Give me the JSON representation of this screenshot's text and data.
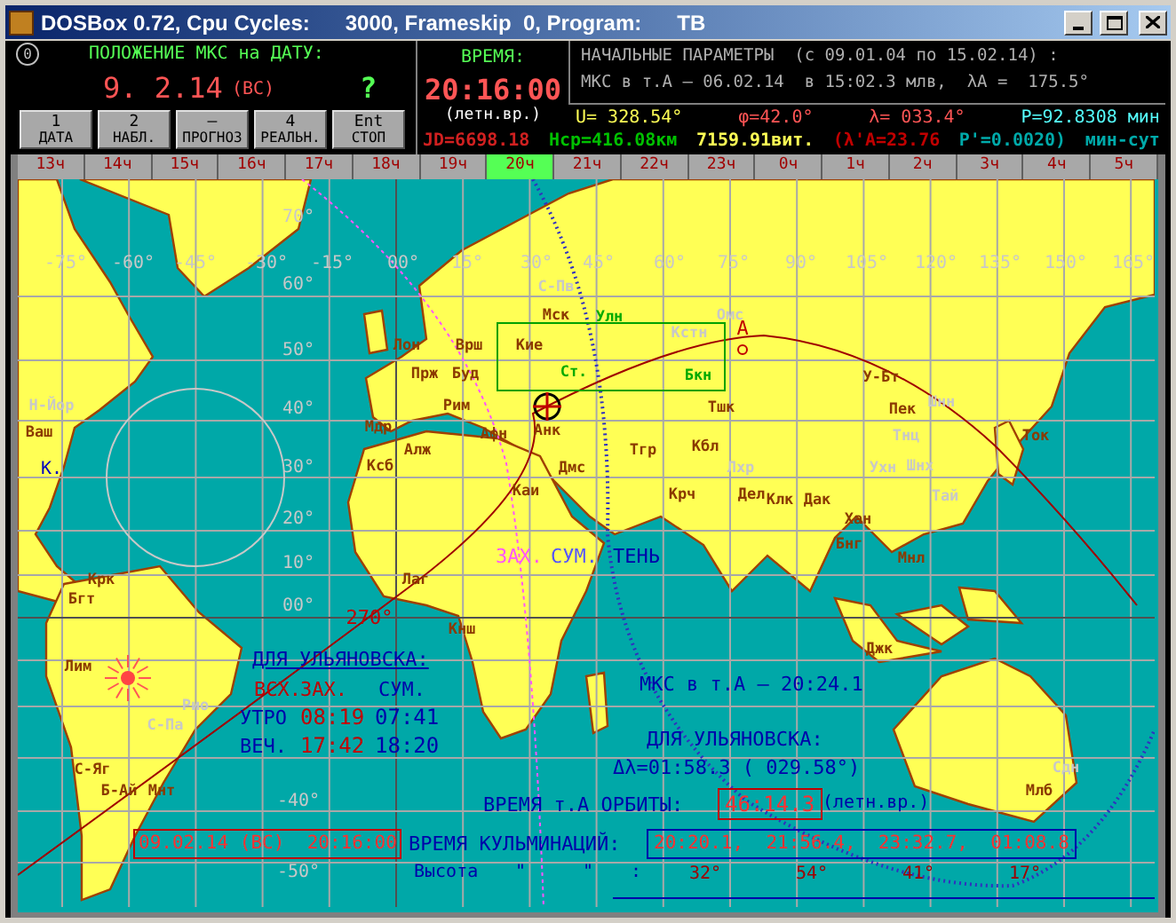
{
  "window": {
    "title": "DOSBox 0.72, Cpu Cycles:      3000, Frameskip  0, Program:      TB"
  },
  "header": {
    "badge": "0",
    "heading": "ПОЛОЖЕНИЕ МКС на ДАТУ:",
    "date": "9. 2.14",
    "weekday": "(ВС)",
    "query": "?",
    "buttons": [
      {
        "key": "1",
        "label": "ДАТА"
      },
      {
        "key": "2",
        "label": "НАБЛ."
      },
      {
        "key": "–",
        "label": "ПРОГНОЗ"
      },
      {
        "key": "4",
        "label": "РЕАЛЬН."
      },
      {
        "key": "Ent",
        "label": "СТОП"
      }
    ],
    "time_heading": "ВРЕМЯ:",
    "time": "20:16:00",
    "time_note": "(летн.вр.)",
    "params_title": "НАЧАЛЬНЫЕ ПАРАМЕТРЫ  (с 09.01.04 по 15.02.14) :",
    "params_line": "МКС в т.А – 06.02.14  в 15:02.3 млв,  λA =  175.5°",
    "readings": [
      {
        "text": "U= 328.54°",
        "color": "#ffff55"
      },
      {
        "text": "φ=42.0°",
        "color": "#ff5555"
      },
      {
        "text": "λ= 033.4°",
        "color": "#ff5555"
      },
      {
        "text": "P=92.8308 мин",
        "color": "#55ffff"
      }
    ],
    "stats": [
      {
        "text": "JD=6698.18",
        "color": "#d02020"
      },
      {
        "text": "Hср=416.08км",
        "color": "#00c000"
      },
      {
        "text": "7159.91вит.",
        "color": "#ffff55"
      },
      {
        "text": "(λ'A=23.76",
        "color": "#c00000"
      },
      {
        "text": "P'=0.0020)",
        "color": "#00aaaa"
      },
      {
        "text": "мин-сут",
        "color": "#00aaaa"
      }
    ]
  },
  "hours": [
    {
      "label": "13ч",
      "selected": false
    },
    {
      "label": "14ч",
      "selected": false
    },
    {
      "label": "15ч",
      "selected": false
    },
    {
      "label": "16ч",
      "selected": false
    },
    {
      "label": "17ч",
      "selected": false
    },
    {
      "label": "18ч",
      "selected": false
    },
    {
      "label": "19ч",
      "selected": false
    },
    {
      "label": "20ч",
      "selected": true
    },
    {
      "label": "21ч",
      "selected": false
    },
    {
      "label": "22ч",
      "selected": false
    },
    {
      "label": "23ч",
      "selected": false
    },
    {
      "label": "0ч",
      "selected": false
    },
    {
      "label": "1ч",
      "selected": false
    },
    {
      "label": "2ч",
      "selected": false
    },
    {
      "label": "3ч",
      "selected": false
    },
    {
      "label": "4ч",
      "selected": false
    },
    {
      "label": "5ч",
      "selected": false
    }
  ],
  "map": {
    "longitudes": [
      "-75°",
      "-60°",
      "-45°",
      "-30°",
      "-15°",
      "00°",
      "15°",
      "30°",
      "45°",
      "60°",
      "75°",
      "90°",
      "105°",
      "120°",
      "135°",
      "150°",
      "165°"
    ],
    "latitudes": [
      "70°",
      "60°",
      "50°",
      "40°",
      "30°",
      "20°",
      "10°",
      "00°",
      "-40°",
      "-50°"
    ],
    "cities": [
      {
        "name": "С-Пв",
        "color": "#c8c8c8"
      },
      {
        "name": "Мск",
        "color": "#8b3a00"
      },
      {
        "name": "Улн",
        "color": "#00aa00"
      },
      {
        "name": "Омс",
        "color": "#c8c8c8"
      },
      {
        "name": "Кстн",
        "color": "#c8c8c8"
      },
      {
        "name": "Лон",
        "color": "#8b3a00"
      },
      {
        "name": "Врш",
        "color": "#8b3a00"
      },
      {
        "name": "Кие",
        "color": "#8b3a00"
      },
      {
        "name": "Прж",
        "color": "#8b3a00"
      },
      {
        "name": "Буд",
        "color": "#8b3a00"
      },
      {
        "name": "Ст.",
        "color": "#00aa00"
      },
      {
        "name": "Бкн",
        "color": "#00aa00"
      },
      {
        "name": "У-Бт",
        "color": "#8b3a00"
      },
      {
        "name": "Н-Йор",
        "color": "#c8c8c8"
      },
      {
        "name": "Рим",
        "color": "#8b3a00"
      },
      {
        "name": "Тшк",
        "color": "#8b3a00"
      },
      {
        "name": "Пек",
        "color": "#8b3a00"
      },
      {
        "name": "Шнн",
        "color": "#c8c8c8"
      },
      {
        "name": "Ваш",
        "color": "#8b3a00"
      },
      {
        "name": "Мдр",
        "color": "#8b3a00"
      },
      {
        "name": "Афн",
        "color": "#8b3a00"
      },
      {
        "name": "Анк",
        "color": "#8b3a00"
      },
      {
        "name": "Тнц",
        "color": "#c8c8c8"
      },
      {
        "name": "Ток",
        "color": "#8b3a00"
      },
      {
        "name": "Алж",
        "color": "#8b3a00"
      },
      {
        "name": "Тгр",
        "color": "#8b3a00"
      },
      {
        "name": "Кбл",
        "color": "#8b3a00"
      },
      {
        "name": "Ксб",
        "color": "#8b3a00"
      },
      {
        "name": "Дмс",
        "color": "#8b3a00"
      },
      {
        "name": "Лхр",
        "color": "#c8c8c8"
      },
      {
        "name": "Ухн",
        "color": "#c8c8c8"
      },
      {
        "name": "Шнх",
        "color": "#c8c8c8"
      },
      {
        "name": "Каи",
        "color": "#8b3a00"
      },
      {
        "name": "Крч",
        "color": "#8b3a00"
      },
      {
        "name": "Дел",
        "color": "#8b3a00"
      },
      {
        "name": "Клк",
        "color": "#8b3a00"
      },
      {
        "name": "Дак",
        "color": "#8b3a00"
      },
      {
        "name": "Тай",
        "color": "#c8c8c8"
      },
      {
        "name": "Хан",
        "color": "#8b3a00"
      },
      {
        "name": "Бнг",
        "color": "#8b3a00"
      },
      {
        "name": "Мнл",
        "color": "#8b3a00"
      },
      {
        "name": "Крк",
        "color": "#8b3a00"
      },
      {
        "name": "Лаг",
        "color": "#8b3a00"
      },
      {
        "name": "Бгт",
        "color": "#8b3a00"
      },
      {
        "name": "Кнш",
        "color": "#8b3a00"
      },
      {
        "name": "Джк",
        "color": "#8b3a00"
      },
      {
        "name": "Лим",
        "color": "#8b3a00"
      },
      {
        "name": "Рио",
        "color": "#c8c8c8"
      },
      {
        "name": "С-Па",
        "color": "#c8c8c8"
      },
      {
        "name": "С-Яг",
        "color": "#8b3a00"
      },
      {
        "name": "Сдн",
        "color": "#c8c8c8"
      },
      {
        "name": "Б-Ай",
        "color": "#8b3a00"
      },
      {
        "name": "Мнт",
        "color": "#8b3a00"
      },
      {
        "name": "Млб",
        "color": "#8b3a00"
      }
    ],
    "point": "А",
    "angle": "270°",
    "site": "К.",
    "shadow_labels": [
      {
        "text": "ЗАХ.",
        "color": "#ff55ff"
      },
      {
        "text": "СУМ.",
        "color": "#5555ff"
      },
      {
        "text": "ТЕНЬ",
        "color": "#0000aa"
      }
    ],
    "sun_panel": {
      "title": "ДЛЯ УЛЬЯНОВСКА:",
      "headers": [
        "ВСХ.",
        "ЗАХ.",
        "СУМ."
      ],
      "rows": [
        {
          "label": "УТРО",
          "times": [
            "08:19",
            "07:41"
          ]
        },
        {
          "label": "ВЕЧ.",
          "times": [
            "17:42",
            "18:20"
          ]
        }
      ]
    },
    "orbit_panel": {
      "pass_time": "МКС в т.А – 20:24.1",
      "title": "ДЛЯ УЛЬЯНОВСКА:",
      "delta": "Δλ=01:58.3 ( 029.58°)",
      "period_label": "ВРЕМЯ т.А ОРБИТЫ:",
      "period": "46:14.3",
      "period_note": "(летн.вр.)"
    },
    "bottom": {
      "datetime": "09.02.14 (ВС)  20:16:00",
      "culmination_label": "ВРЕМЯ КУЛЬМИНАЦИЙ:",
      "culminations": "20:20.1,  21:56.4,  23:32.7,  01:08.8",
      "height_label": "Высота",
      "ditto": [
        "\"",
        "\"",
        ":"
      ],
      "heights": [
        "32°",
        "54°",
        "41°",
        "17°"
      ]
    }
  }
}
